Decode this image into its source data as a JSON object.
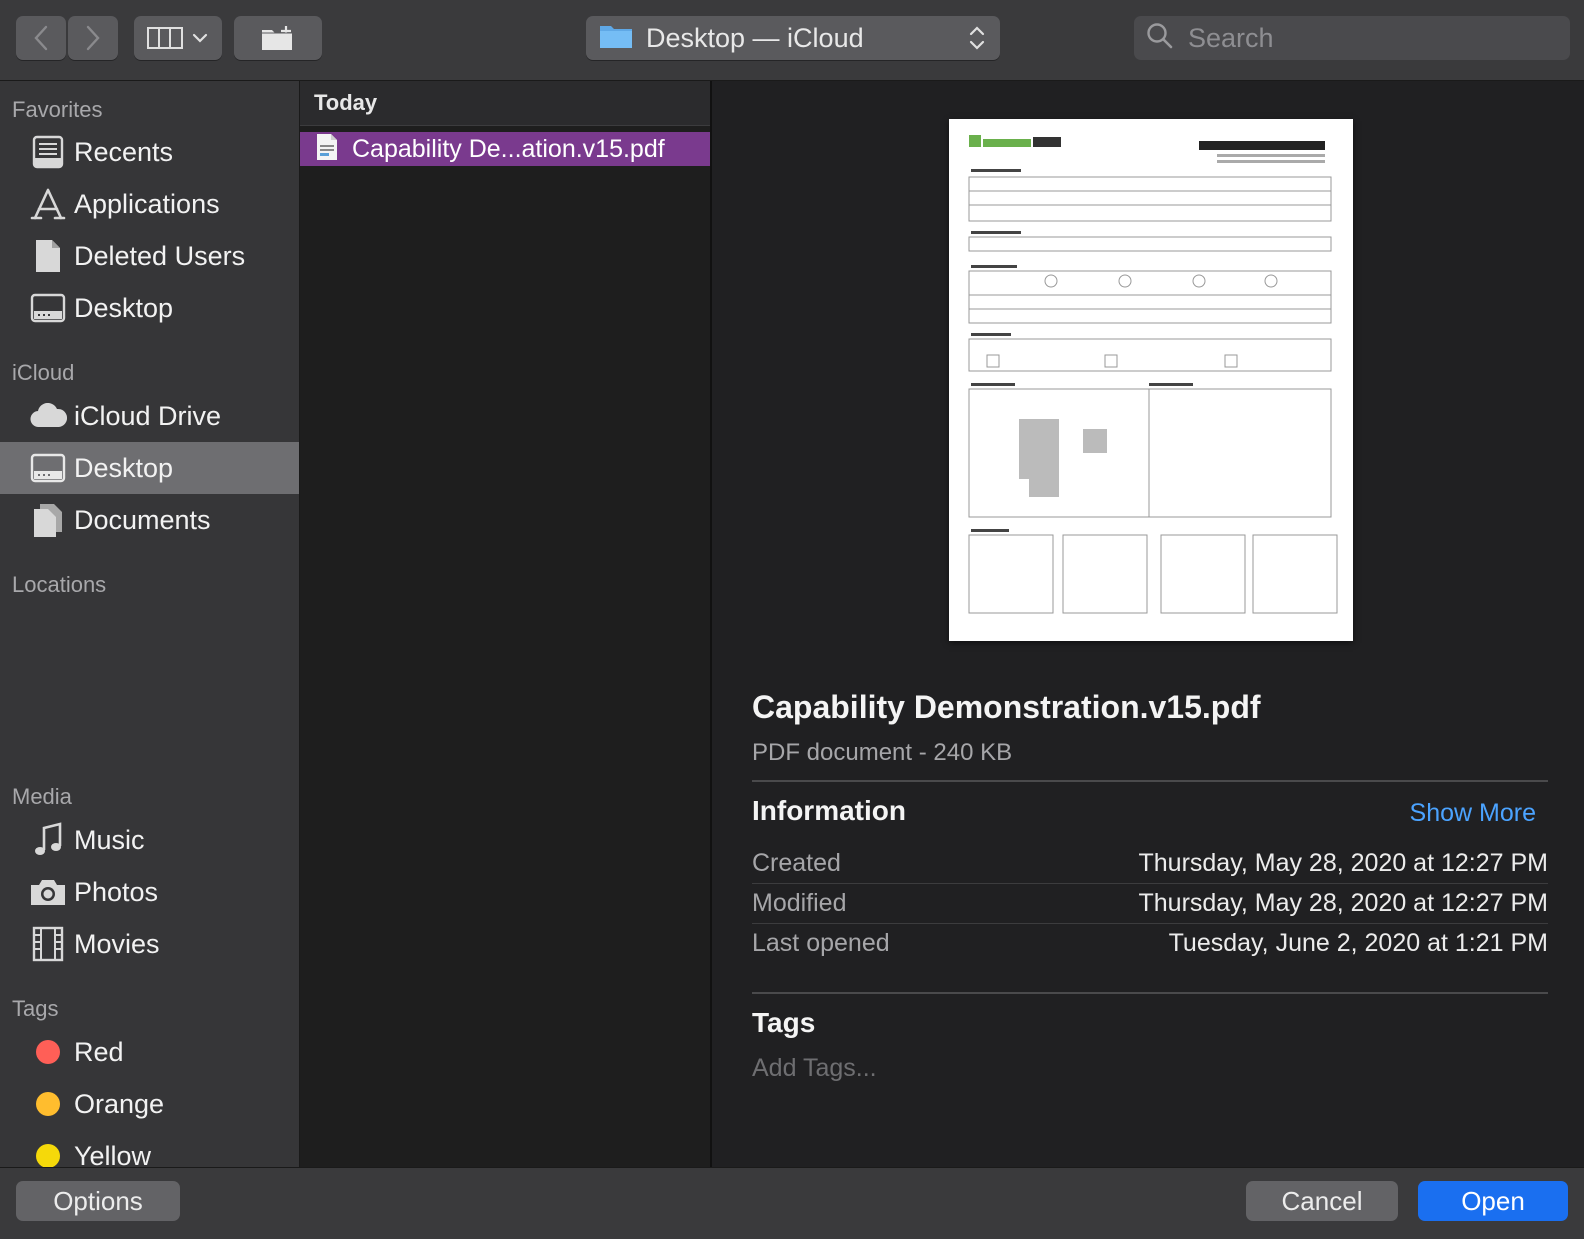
{
  "toolbar": {
    "back_icon": "chevron-left-icon",
    "forward_icon": "chevron-right-icon",
    "view_icon": "column-view-icon",
    "new_folder_icon": "new-folder-icon",
    "location": "Desktop — iCloud",
    "search_placeholder": "Search"
  },
  "sidebar": {
    "favorites_label": "Favorites",
    "favorites": [
      {
        "label": "Recents",
        "icon": "recents-icon"
      },
      {
        "label": "Applications",
        "icon": "applications-icon"
      },
      {
        "label": "Deleted Users",
        "icon": "document-icon"
      },
      {
        "label": "Desktop",
        "icon": "desktop-icon"
      }
    ],
    "icloud_label": "iCloud",
    "icloud": [
      {
        "label": "iCloud Drive",
        "icon": "cloud-icon"
      },
      {
        "label": "Desktop",
        "icon": "desktop-icon",
        "selected": true
      },
      {
        "label": "Documents",
        "icon": "documents-icon"
      }
    ],
    "locations_label": "Locations",
    "media_label": "Media",
    "media": [
      {
        "label": "Music",
        "icon": "music-note-icon"
      },
      {
        "label": "Photos",
        "icon": "camera-icon"
      },
      {
        "label": "Movies",
        "icon": "film-icon"
      }
    ],
    "tags_label": "Tags",
    "tags": [
      {
        "label": "Red",
        "color": "#ff5f57"
      },
      {
        "label": "Orange",
        "color": "#ffbd2e"
      },
      {
        "label": "Yellow",
        "color": "#f5d90a"
      }
    ]
  },
  "column": {
    "header": "Today",
    "file_name": "Capability De...ation.v15.pdf"
  },
  "preview": {
    "title": "Capability Demonstration.v15.pdf",
    "subtitle": "PDF document - 240 KB",
    "information_label": "Information",
    "show_more": "Show More",
    "info": [
      {
        "key": "Created",
        "value": "Thursday, May 28, 2020 at 12:27 PM"
      },
      {
        "key": "Modified",
        "value": "Thursday, May 28, 2020 at 12:27 PM"
      },
      {
        "key": "Last opened",
        "value": "Tuesday, June 2, 2020 at 1:21 PM"
      }
    ],
    "tags_label": "Tags",
    "add_tags": "Add Tags..."
  },
  "buttons": {
    "options": "Options",
    "cancel": "Cancel",
    "open": "Open"
  },
  "colors": {
    "selection": "#7a3a8e",
    "accent": "#1a6ff0",
    "link": "#4ba3ff"
  }
}
